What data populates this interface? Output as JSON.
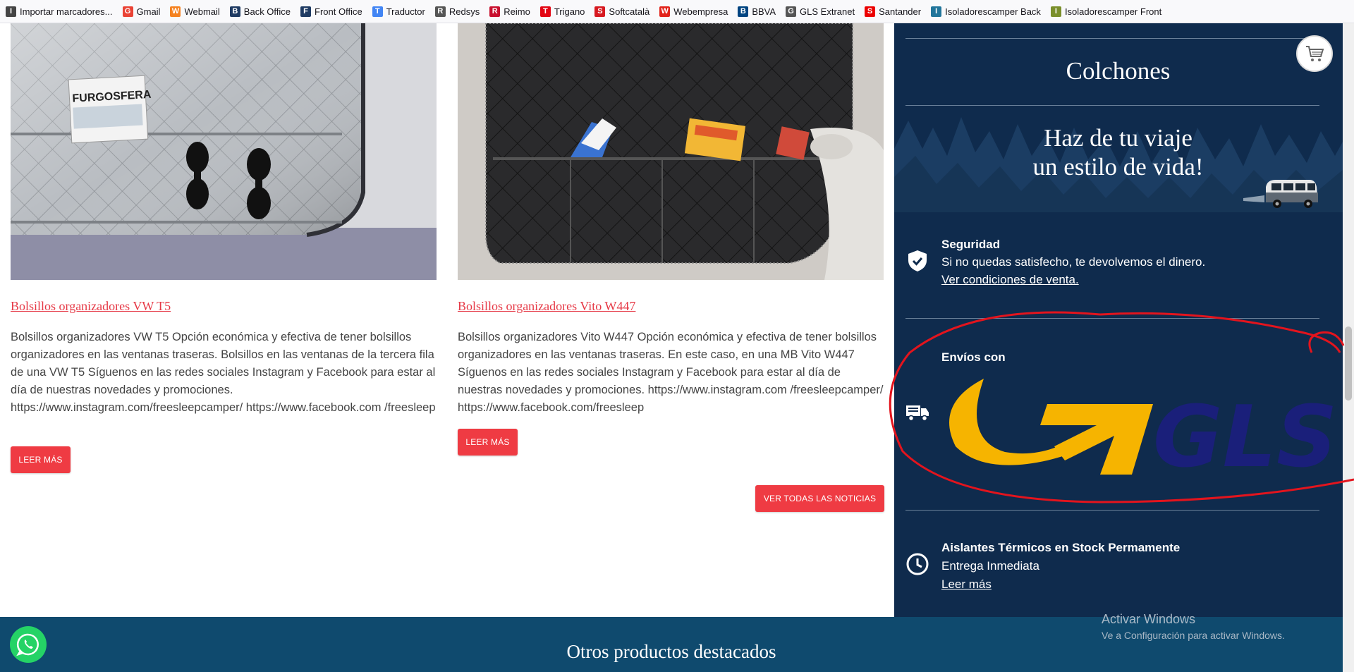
{
  "bookmarks": [
    {
      "label": "Importar marcadores...",
      "icon": "import-icon",
      "color": "#444444"
    },
    {
      "label": "Gmail",
      "icon": "gmail-icon",
      "color": "#ea4335"
    },
    {
      "label": "Webmail",
      "icon": "webmail-icon",
      "color": "#f58220"
    },
    {
      "label": "Back Office",
      "icon": "shop-icon",
      "color": "#1f3b63"
    },
    {
      "label": "Front Office",
      "icon": "shop-icon",
      "color": "#1f3b63"
    },
    {
      "label": "Traductor",
      "icon": "translate-icon",
      "color": "#4285f4"
    },
    {
      "label": "Redsys",
      "icon": "globe-icon",
      "color": "#555555"
    },
    {
      "label": "Reimo",
      "icon": "flag-icon",
      "color": "#c8102e"
    },
    {
      "label": "Trigano",
      "icon": "trigano-icon",
      "color": "#e30613"
    },
    {
      "label": "Softcatalà",
      "icon": "softcatala-icon",
      "color": "#d71920"
    },
    {
      "label": "Webempresa",
      "icon": "webempresa-icon",
      "color": "#e2231a"
    },
    {
      "label": "BBVA",
      "icon": "bbva-icon",
      "color": "#004481"
    },
    {
      "label": "GLS Extranet",
      "icon": "globe-icon",
      "color": "#555555"
    },
    {
      "label": "Santander",
      "icon": "santander-icon",
      "color": "#ec0000"
    },
    {
      "label": "Isoladorescamper Back",
      "icon": "wordpress-icon",
      "color": "#21759b"
    },
    {
      "label": "Isoladorescamper Front",
      "icon": "image-icon",
      "color": "#7a8f2b"
    }
  ],
  "cards": [
    {
      "title": "Bolsillos organizadores VW T5",
      "text": "Bolsillos organizadores VW T5 Opción económica y efectiva de tener bolsillos organizadores en las ventanas traseras. Bolsillos en las ventanas de la tercera fila de una VW T5 Síguenos en las redes sociales Instagram y Facebook para estar al día de nuestras novedades y promociones. https://www.instagram.com/freesleepcamper/ https://www.facebook.com /freesleep",
      "button": "LEER MÁS",
      "magazine": "FURGOSFERA"
    },
    {
      "title": "Bolsillos organizadores Vito W447",
      "text": "Bolsillos organizadores Vito W447 Opción económica y efectiva de tener bolsillos organizadores en las ventanas traseras. En este caso, en una MB Vito W447 Síguenos en las redes sociales Instagram y Facebook para estar al día de nuestras novedades y promociones. https://www.instagram.com /freesleepcamper/ https://www.facebook.com/freesleep",
      "button": "LEER MÁS"
    }
  ],
  "all_news_button": "VER TODAS LAS NOTICIAS",
  "sidebar": {
    "colchones": "Colchones",
    "slogan_line1": "Haz de tu viaje",
    "slogan_line2": "un estilo de vida!",
    "seguridad_title": "Seguridad",
    "seguridad_text": "Si no quedas satisfecho, te devolvemos el dinero.",
    "seguridad_link": "Ver condiciones de venta.",
    "envios_title": "Envíos con",
    "gls_logo": "GLS",
    "stock_title": "Aislantes Térmicos en Stock Permamente",
    "stock_text": "Entrega Inmediata",
    "stock_link": "Leer más"
  },
  "bottom": {
    "title": "Otros productos destacados"
  },
  "watermark": {
    "line1": "Activar Windows",
    "line2": "Ve a Configuración para activar Windows."
  },
  "colors": {
    "accent_red": "#ef3b43",
    "sidebar_bg": "#0f2b4d",
    "bottom_bg": "#0f4a6e",
    "gls_yellow": "#f6b400",
    "gls_blue": "#1a1f7a",
    "annotation_red": "#e3141d"
  }
}
